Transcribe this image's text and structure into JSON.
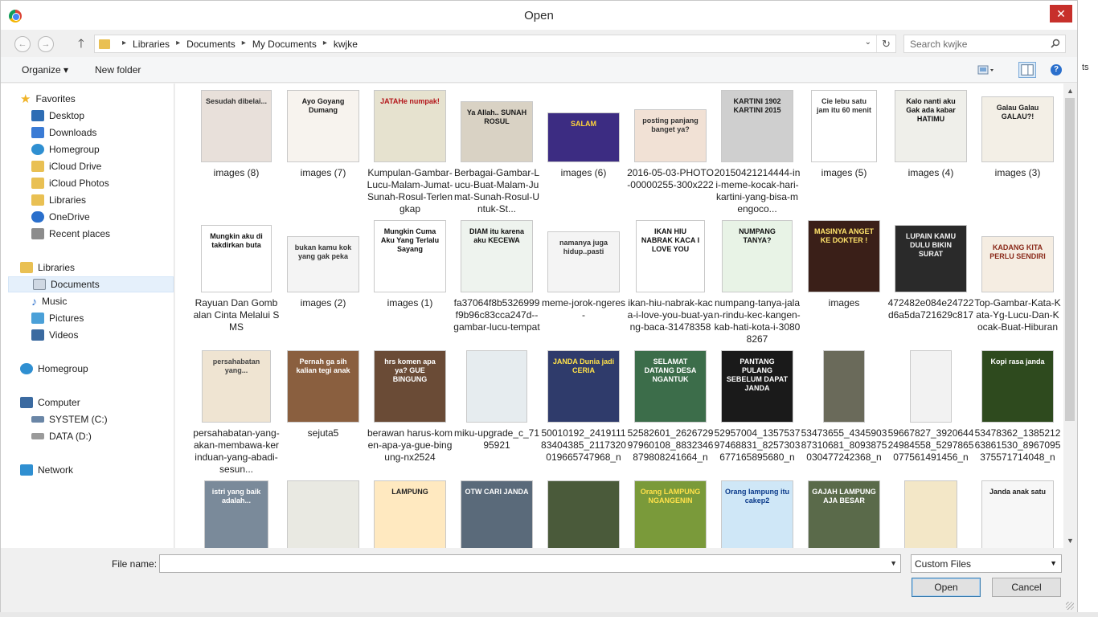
{
  "window": {
    "title": "Open",
    "close_glyph": "✕"
  },
  "nav": {
    "back_glyph": "←",
    "forward_glyph": "→",
    "up_glyph": "🡑",
    "breadcrumb": [
      "Libraries",
      "Documents",
      "My Documents",
      "kwjke"
    ],
    "refresh_glyph": "↻",
    "search_placeholder": "Search kwjke"
  },
  "toolbar": {
    "organize": "Organize ▾",
    "new_folder": "New folder",
    "help": "?"
  },
  "sidebar": {
    "items": [
      {
        "label": "Favorites",
        "icon": "star-icon",
        "color": "#f0b429"
      },
      {
        "label": "Desktop",
        "icon": "desktop-icon",
        "color": "#2e6db4"
      },
      {
        "label": "Downloads",
        "icon": "downloads-icon",
        "color": "#3a7bd5"
      },
      {
        "label": "Homegroup",
        "icon": "homegroup-icon",
        "color": "#2f8fd1"
      },
      {
        "label": "iCloud Drive",
        "icon": "folder-icon",
        "color": "#e9c053"
      },
      {
        "label": "iCloud Photos",
        "icon": "folder-icon",
        "color": "#e9c053"
      },
      {
        "label": "Libraries",
        "icon": "library-icon",
        "color": "#e9c053"
      },
      {
        "label": "OneDrive",
        "icon": "onedrive-icon",
        "color": "#2a6fcc"
      },
      {
        "label": "Recent places",
        "icon": "recent-icon",
        "color": "#8c8c8c"
      },
      {
        "label": "Libraries",
        "icon": "library-icon",
        "color": "#e9c053"
      },
      {
        "label": "Documents",
        "icon": "documents-icon",
        "color": "#cfd8e3"
      },
      {
        "label": "Music",
        "icon": "music-icon",
        "color": "#2a6fcc"
      },
      {
        "label": "Pictures",
        "icon": "pictures-icon",
        "color": "#4aa0d8"
      },
      {
        "label": "Videos",
        "icon": "videos-icon",
        "color": "#3b6aa0"
      },
      {
        "label": "Homegroup",
        "icon": "homegroup-icon",
        "color": "#2f8fd1"
      },
      {
        "label": "Computer",
        "icon": "computer-icon",
        "color": "#3b6aa0"
      },
      {
        "label": "SYSTEM (C:)",
        "icon": "drive-icon",
        "color": "#6a86a6"
      },
      {
        "label": "DATA (D:)",
        "icon": "drive-icon",
        "color": "#9a9a9a"
      },
      {
        "label": "Network",
        "icon": "network-icon",
        "color": "#2f8fd1"
      }
    ]
  },
  "files": [
    {
      "name": "images (8)",
      "thumb_text": "Sesudah dibelai...",
      "bg": "#e8e0da",
      "fg": "#333333"
    },
    {
      "name": "images (7)",
      "thumb_text": "Ayo Goyang Dumang",
      "bg": "#f7f3ee",
      "fg": "#1a1a1a"
    },
    {
      "name": "Kumpulan-Gambar-Lucu-Malam-Jumat-Sunah-Rosul-Terlengkap",
      "thumb_text": "JATAHe numpak!",
      "bg": "#e6e2cf",
      "fg": "#b3151a"
    },
    {
      "name": "Berbagai-Gambar-Lucu-Buat-Malam-Jumat-Sunah-Rosul-Untuk-St...",
      "thumb_text": "Ya Allah.. SUNAH ROSUL",
      "bg": "#d9d2c4",
      "fg": "#1a1a1a"
    },
    {
      "name": "images (6)",
      "thumb_text": "SALAM",
      "bg": "#3c2c82",
      "fg": "#ffd43a"
    },
    {
      "name": "2016-05-03-PHOTO-00000255-300x222",
      "thumb_text": "posting panjang banget ya?",
      "bg": "#f1e1d5",
      "fg": "#333333"
    },
    {
      "name": "20150421214444-ini-meme-kocak-hari-kartini-yang-bisa-mengoco...",
      "thumb_text": "KARTINI 1902  KARTINI 2015",
      "bg": "#cfcfcf",
      "fg": "#1a1a1a"
    },
    {
      "name": "images (5)",
      "thumb_text": "Cie lebu satu jam itu 60 menit",
      "bg": "#ffffff",
      "fg": "#333333"
    },
    {
      "name": "images (4)",
      "thumb_text": "Kalo nanti aku Gak ada kabar HATIMU",
      "bg": "#efefea",
      "fg": "#111111"
    },
    {
      "name": "images (3)",
      "thumb_text": "Galau Galau GALAU?!",
      "bg": "#f3efe6",
      "fg": "#222222"
    },
    {
      "name": "Rayuan Dan Gombalan Cinta Melalui SMS",
      "thumb_text": "Mungkin aku di takdirkan buta",
      "bg": "#ffffff",
      "fg": "#111111"
    },
    {
      "name": "images (2)",
      "thumb_text": "bukan kamu kok yang gak peka",
      "bg": "#f4f4f4",
      "fg": "#333333"
    },
    {
      "name": "images (1)",
      "thumb_text": "Mungkin Cuma Aku Yang Terlalu Sayang",
      "bg": "#ffffff",
      "fg": "#111111"
    },
    {
      "name": "fa37064f8b5326999f9b96c83cca247d--gambar-lucu-tempat",
      "thumb_text": "DIAM itu karena aku KECEWA",
      "bg": "#eef3ee",
      "fg": "#111111"
    },
    {
      "name": "meme-jorok-ngeres-",
      "thumb_text": "namanya juga hidup..pasti",
      "bg": "#f4f4f4",
      "fg": "#333333"
    },
    {
      "name": "ikan-hiu-nabrak-kaca-i-love-you-buat-yang-baca-31478358",
      "thumb_text": "IKAN HIU NABRAK KACA I LOVE YOU",
      "bg": "#ffffff",
      "fg": "#111111"
    },
    {
      "name": "numpang-tanya-jalan-rindu-kec-kangen-kab-hati-kota-i-30808267",
      "thumb_text": "NUMPANG TANYA?",
      "bg": "#e8f3e6",
      "fg": "#111111"
    },
    {
      "name": "images",
      "thumb_text": "MASINYA ANGET KE DOKTER !",
      "bg": "#3a1f18",
      "fg": "#ffe46b"
    },
    {
      "name": "472482e084e24722d6a5da721629c817",
      "thumb_text": "LUPAIN KAMU DULU BIKIN SURAT",
      "bg": "#2a2a2a",
      "fg": "#f3f3f3"
    },
    {
      "name": "Top-Gambar-Kata-Kata-Yg-Lucu-Dan-Kocak-Buat-Hiburan",
      "thumb_text": "KADANG KITA PERLU SENDIRI",
      "bg": "#f5ede2",
      "fg": "#8a2a1a"
    },
    {
      "name": "persahabatan-yang-akan-membawa-kerinduan-yang-abadi-sesun...",
      "thumb_text": "persahabatan yang...",
      "bg": "#efe4d2",
      "fg": "#444444"
    },
    {
      "name": "sejuta5",
      "thumb_text": "Pernah ga sih kalian tegi anak",
      "bg": "#8a5f3f",
      "fg": "#ffffff"
    },
    {
      "name": "berawan harus-komen-apa-ya-gue-bingung-nx2524",
      "thumb_text": "hrs komen apa ya? GUE BINGUNG",
      "bg": "#6a4b36",
      "fg": "#ffffff"
    },
    {
      "name": "miku-upgrade_c_7195921",
      "thumb_text": "",
      "bg": "#e6ecef",
      "fg": "#333333"
    },
    {
      "name": "50010192_241911183404385_2117320019665747968_n",
      "thumb_text": "JANDA Dunia jadi CERIA",
      "bg": "#2f3b6b",
      "fg": "#ffe14a"
    },
    {
      "name": "52582601_262672997960108_8832346879808241664_n",
      "thumb_text": "SELAMAT DATANG DESA NGANTUK",
      "bg": "#3c6d4a",
      "fg": "#ffffff"
    },
    {
      "name": "52957004_135753797468831_8257303677165895680_n",
      "thumb_text": "PANTANG PULANG SEBELUM DAPAT JANDA",
      "bg": "#1a1a1a",
      "fg": "#ffffff"
    },
    {
      "name": "53473655_434590387310681_8093875030477242368_n",
      "thumb_text": "",
      "bg": "#6a6a5a",
      "fg": "#ffffff"
    },
    {
      "name": "59667827_392064424984558_5297865077561491456_n",
      "thumb_text": "",
      "bg": "#f2f2f2",
      "fg": "#1e6b3a"
    },
    {
      "name": "53478362_138521263861530_8967095375571714048_n",
      "thumb_text": "Kopi rasa janda",
      "bg": "#2e4a1e",
      "fg": "#ffffff"
    },
    {
      "name": "",
      "thumb_text": "istri yang baik adalah...",
      "bg": "#7a8a9a",
      "fg": "#ffffff"
    },
    {
      "name": "",
      "thumb_text": "",
      "bg": "#e9e9e2",
      "fg": "#333333"
    },
    {
      "name": "",
      "thumb_text": "LAMPUNG",
      "bg": "#ffe9c0",
      "fg": "#222222"
    },
    {
      "name": "",
      "thumb_text": "OTW CARI JANDA",
      "bg": "#5a6a7a",
      "fg": "#ffffff"
    },
    {
      "name": "",
      "thumb_text": "",
      "bg": "#4a5a3a",
      "fg": "#ffffff"
    },
    {
      "name": "",
      "thumb_text": "Orang LAMPUNG NGANGENIN",
      "bg": "#7a9a3a",
      "fg": "#ffe14a"
    },
    {
      "name": "",
      "thumb_text": "Orang lampung itu cakep2",
      "bg": "#cfe7f7",
      "fg": "#0a3a8a"
    },
    {
      "name": "",
      "thumb_text": "GAJAH LAMPUNG AJA BESAR",
      "bg": "#5a6a4a",
      "fg": "#ffffff"
    },
    {
      "name": "",
      "thumb_text": "",
      "bg": "#f3e7c7",
      "fg": "#333333"
    },
    {
      "name": "",
      "thumb_text": "Janda anak satu",
      "bg": "#f7f7f7",
      "fg": "#222222"
    }
  ],
  "bottom": {
    "file_name_label": "File name:",
    "file_name_value": "",
    "file_type": "Custom Files",
    "open_label": "Open",
    "cancel_label": "Cancel"
  },
  "background_text": "ts"
}
